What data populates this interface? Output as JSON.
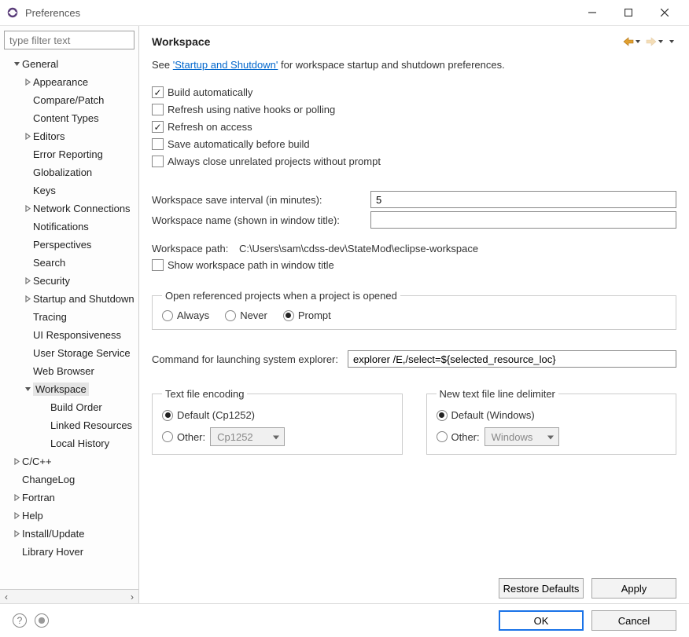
{
  "window": {
    "title": "Preferences"
  },
  "sidebar": {
    "filter_placeholder": "type filter text",
    "tree": [
      {
        "label": "General",
        "indent": 0,
        "expanded": true,
        "has_children": true
      },
      {
        "label": "Appearance",
        "indent": 1,
        "expanded": false,
        "has_children": true
      },
      {
        "label": "Compare/Patch",
        "indent": 1,
        "has_children": false
      },
      {
        "label": "Content Types",
        "indent": 1,
        "has_children": false
      },
      {
        "label": "Editors",
        "indent": 1,
        "expanded": false,
        "has_children": true
      },
      {
        "label": "Error Reporting",
        "indent": 1,
        "has_children": false
      },
      {
        "label": "Globalization",
        "indent": 1,
        "has_children": false
      },
      {
        "label": "Keys",
        "indent": 1,
        "has_children": false
      },
      {
        "label": "Network Connections",
        "indent": 1,
        "expanded": false,
        "has_children": true
      },
      {
        "label": "Notifications",
        "indent": 1,
        "has_children": false
      },
      {
        "label": "Perspectives",
        "indent": 1,
        "has_children": false
      },
      {
        "label": "Search",
        "indent": 1,
        "has_children": false
      },
      {
        "label": "Security",
        "indent": 1,
        "expanded": false,
        "has_children": true
      },
      {
        "label": "Startup and Shutdown",
        "indent": 1,
        "expanded": false,
        "has_children": true
      },
      {
        "label": "Tracing",
        "indent": 1,
        "has_children": false
      },
      {
        "label": "UI Responsiveness",
        "indent": 1,
        "has_children": false
      },
      {
        "label": "User Storage Service",
        "indent": 1,
        "has_children": false
      },
      {
        "label": "Web Browser",
        "indent": 1,
        "has_children": false
      },
      {
        "label": "Workspace",
        "indent": 1,
        "expanded": true,
        "has_children": true,
        "selected": true
      },
      {
        "label": "Build Order",
        "indent": 2,
        "has_children": false
      },
      {
        "label": "Linked Resources",
        "indent": 2,
        "has_children": false
      },
      {
        "label": "Local History",
        "indent": 2,
        "has_children": false
      },
      {
        "label": "C/C++",
        "indent": 0,
        "expanded": false,
        "has_children": true
      },
      {
        "label": "ChangeLog",
        "indent": 0,
        "has_children": false
      },
      {
        "label": "Fortran",
        "indent": 0,
        "expanded": false,
        "has_children": true
      },
      {
        "label": "Help",
        "indent": 0,
        "expanded": false,
        "has_children": true
      },
      {
        "label": "Install/Update",
        "indent": 0,
        "expanded": false,
        "has_children": true
      },
      {
        "label": "Library Hover",
        "indent": 0,
        "has_children": false
      }
    ]
  },
  "page": {
    "title": "Workspace",
    "intro_prefix": "See ",
    "intro_link": "'Startup and Shutdown'",
    "intro_suffix": " for workspace startup and shutdown preferences.",
    "checks": {
      "build_auto": {
        "label": "Build automatically",
        "checked": true
      },
      "refresh_native": {
        "label": "Refresh using native hooks or polling",
        "checked": false
      },
      "refresh_access": {
        "label": "Refresh on access",
        "checked": true
      },
      "save_before_build": {
        "label": "Save automatically before build",
        "checked": false
      },
      "close_unrelated": {
        "label": "Always close unrelated projects without prompt",
        "checked": false
      },
      "show_path_title": {
        "label": "Show workspace path in window title",
        "checked": false
      }
    },
    "fields": {
      "save_interval_label": "Workspace save interval (in minutes):",
      "save_interval_value": "5",
      "ws_name_label": "Workspace name (shown in window title):",
      "ws_name_value": "",
      "ws_path_label": "Workspace path:",
      "ws_path_value": "C:\\Users\\sam\\cdss-dev\\StateMod\\eclipse-workspace",
      "launch_cmd_label": "Command for launching system explorer:",
      "launch_cmd_value": "explorer /E,/select=${selected_resource_loc}"
    },
    "open_ref": {
      "legend": "Open referenced projects when a project is opened",
      "options": {
        "always": "Always",
        "never": "Never",
        "prompt": "Prompt"
      },
      "selected": "prompt"
    },
    "encoding": {
      "legend": "Text file encoding",
      "default_label": "Default (Cp1252)",
      "other_label": "Other:",
      "other_value": "Cp1252",
      "selected": "default"
    },
    "delimiter": {
      "legend": "New text file line delimiter",
      "default_label": "Default (Windows)",
      "other_label": "Other:",
      "other_value": "Windows",
      "selected": "default"
    },
    "buttons": {
      "restore": "Restore Defaults",
      "apply": "Apply",
      "ok": "OK",
      "cancel": "Cancel"
    }
  }
}
